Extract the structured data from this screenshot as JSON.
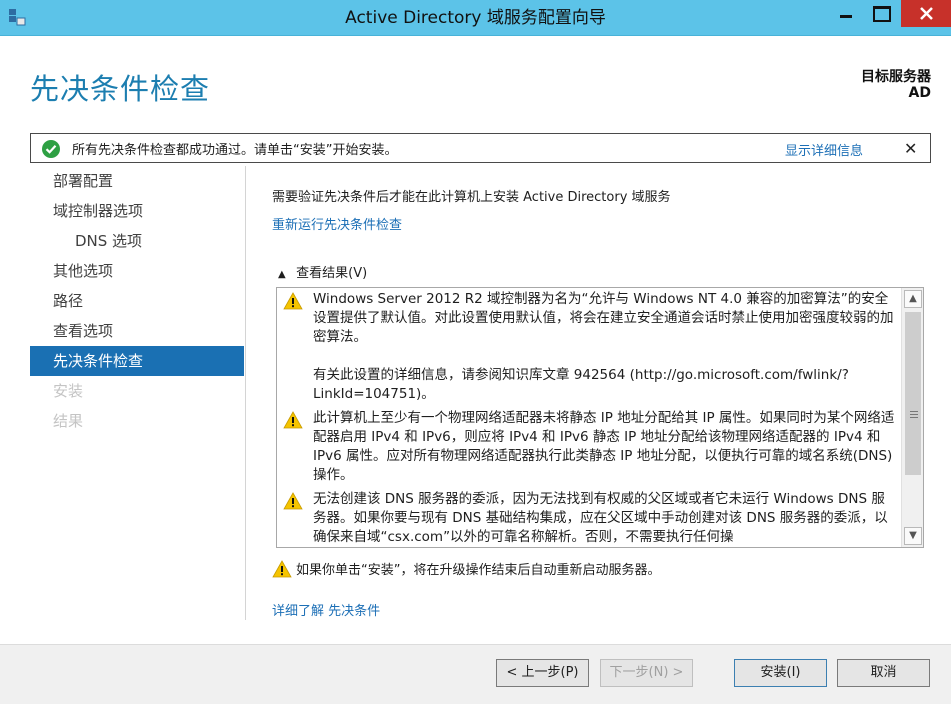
{
  "window": {
    "title": "Active Directory 域服务配置向导"
  },
  "header": {
    "page_title": "先决条件检查",
    "target_label": "目标服务器",
    "target_value": "AD"
  },
  "notification": {
    "message": "所有先决条件检查都成功通过。请单击“安装”开始安装。",
    "details_link": "显示详细信息",
    "close": "✕"
  },
  "nav": {
    "items": [
      {
        "label": "部署配置"
      },
      {
        "label": "域控制器选项"
      },
      {
        "label": "DNS 选项"
      },
      {
        "label": "其他选项"
      },
      {
        "label": "路径"
      },
      {
        "label": "查看选项"
      },
      {
        "label": "先决条件检查"
      },
      {
        "label": "安装"
      },
      {
        "label": "结果"
      }
    ]
  },
  "content": {
    "intro": "需要验证先决条件后才能在此计算机上安装 Active Directory 域服务",
    "rerun_link": "重新运行先决条件检查",
    "results_toggle": "查看结果(V)",
    "results": [
      {
        "p1": "Windows Server 2012 R2 域控制器为名为“允许与 Windows NT 4.0 兼容的加密算法”的安全设置提供了默认值。对此设置使用默认值，将会在建立安全通道会话时禁止使用加密强度较弱的加密算法。",
        "p2": "有关此设置的详细信息，请参阅知识库文章 942564 (http://go.microsoft.com/fwlink/?LinkId=104751)。"
      },
      {
        "p1": "此计算机上至少有一个物理网络适配器未将静态 IP 地址分配给其 IP 属性。如果同时为某个网络适配器启用 IPv4 和 IPv6，则应将 IPv4 和 IPv6 静态 IP 地址分配给该物理网络适配器的 IPv4 和 IPv6 属性。应对所有物理网络适配器执行此类静态 IP 地址分配，以便执行可靠的域名系统(DNS)操作。"
      },
      {
        "p1": "无法创建该 DNS 服务器的委派，因为无法找到有权威的父区域或者它未运行 Windows DNS 服务器。如果你要与现有 DNS 基础结构集成，应在父区域中手动创建对该 DNS 服务器的委派，以确保来自域“csx.com”以外的可靠名称解析。否则，不需要执行任何操"
      }
    ],
    "restart_note": "如果你单击“安装”，将在升级操作结束后自动重新启动服务器。",
    "learn_more": "详细了解 先决条件"
  },
  "footer": {
    "prev": "< 上一步(P)",
    "next": "下一步(N) >",
    "install": "安装(I)",
    "cancel": "取消"
  },
  "colors": {
    "titlebar": "#5cc3e8",
    "accent": "#1a70b3",
    "link": "#1c6fb6",
    "close_button": "#c7312a",
    "success": "#2ea043",
    "warning": "#f5c400"
  }
}
